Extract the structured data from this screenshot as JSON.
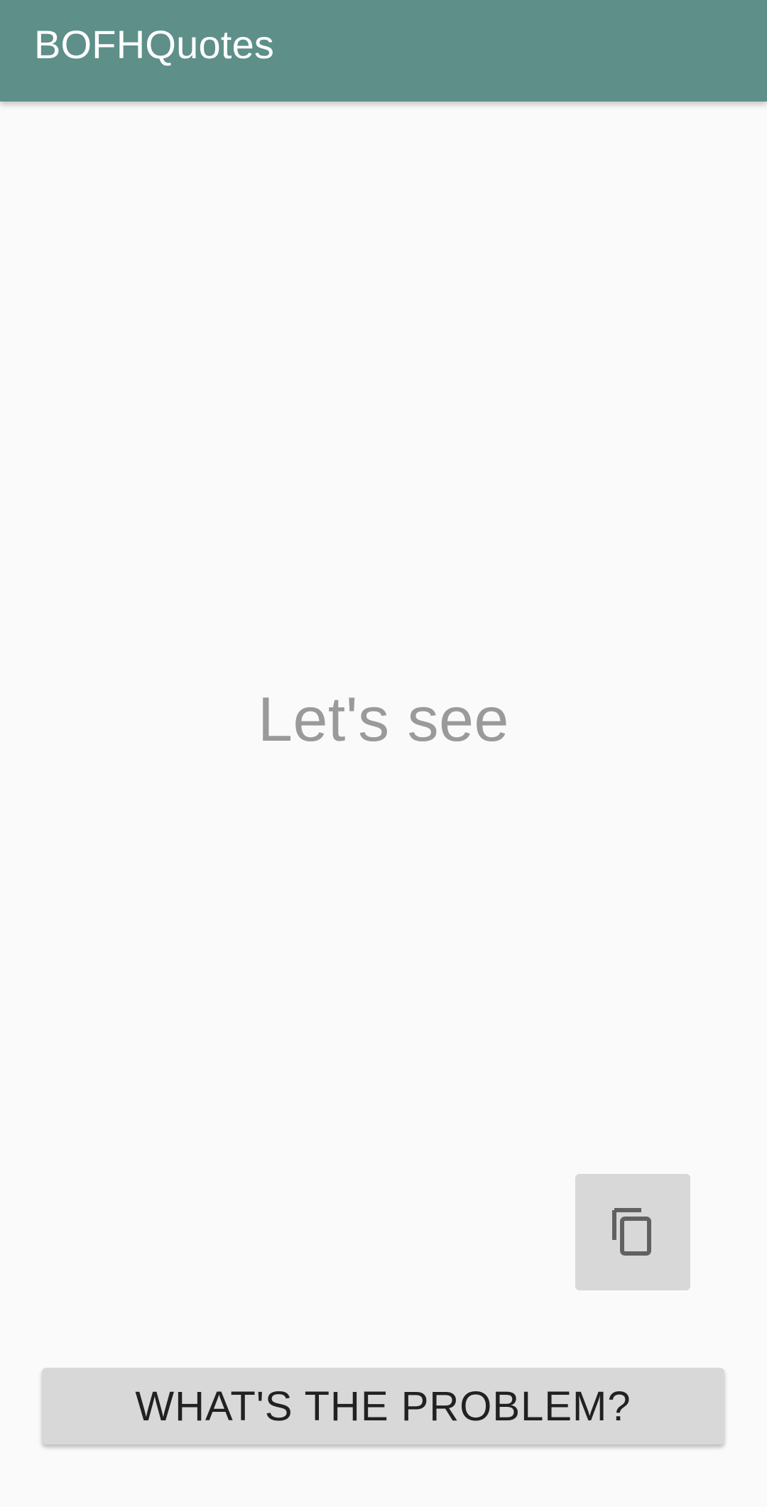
{
  "app_bar": {
    "title": "BOFHQuotes",
    "color": "#5e8f89"
  },
  "main": {
    "quote": "Let's see"
  },
  "actions": {
    "copy_icon": "copy-icon",
    "problem_label": "WHAT'S THE PROBLEM?"
  }
}
